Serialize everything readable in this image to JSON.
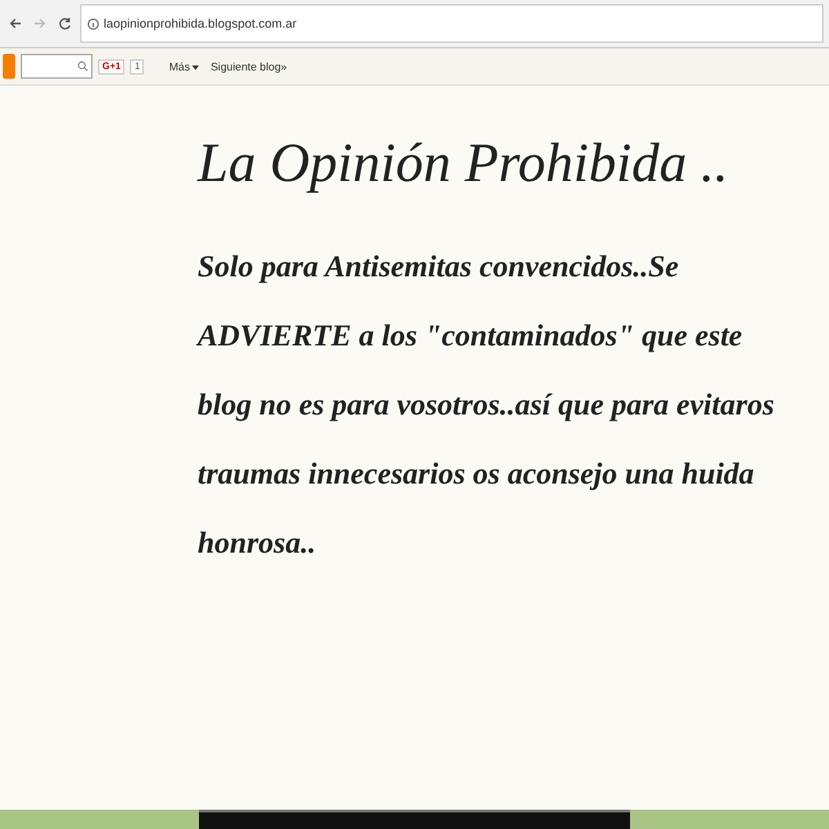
{
  "browser": {
    "url": "laopinionprohibida.blogspot.com.ar"
  },
  "navbar": {
    "gplus": "G+1",
    "count": "1",
    "more": "Más",
    "next_blog": "Siguiente blog»"
  },
  "blog": {
    "title": "La Opinión Prohibida ..",
    "description": "Solo para Antisemitas convencidos..Se ADVIERTE a los \"contaminados\" que este blog no es para vosotros..así que para evitaros traumas innecesarios os aconsejo una huida honrosa.."
  }
}
